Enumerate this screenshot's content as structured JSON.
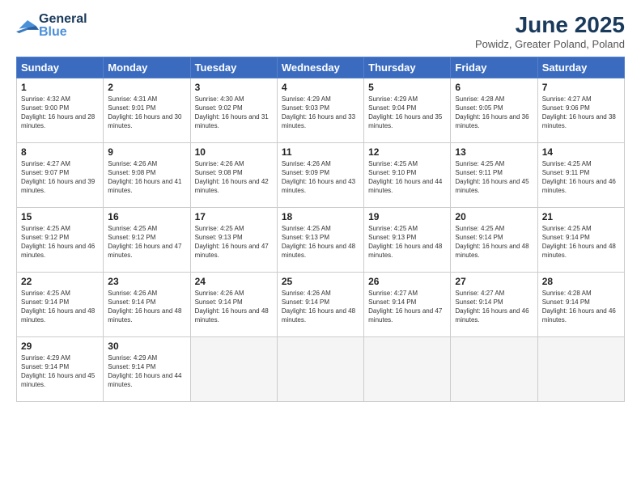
{
  "header": {
    "logo_general": "General",
    "logo_blue": "Blue",
    "title": "June 2025",
    "subtitle": "Powidz, Greater Poland, Poland"
  },
  "days_of_week": [
    "Sunday",
    "Monday",
    "Tuesday",
    "Wednesday",
    "Thursday",
    "Friday",
    "Saturday"
  ],
  "weeks": [
    [
      {
        "day": "1",
        "sunrise": "4:32 AM",
        "sunset": "9:00 PM",
        "daylight": "16 hours and 28 minutes."
      },
      {
        "day": "2",
        "sunrise": "4:31 AM",
        "sunset": "9:01 PM",
        "daylight": "16 hours and 30 minutes."
      },
      {
        "day": "3",
        "sunrise": "4:30 AM",
        "sunset": "9:02 PM",
        "daylight": "16 hours and 31 minutes."
      },
      {
        "day": "4",
        "sunrise": "4:29 AM",
        "sunset": "9:03 PM",
        "daylight": "16 hours and 33 minutes."
      },
      {
        "day": "5",
        "sunrise": "4:29 AM",
        "sunset": "9:04 PM",
        "daylight": "16 hours and 35 minutes."
      },
      {
        "day": "6",
        "sunrise": "4:28 AM",
        "sunset": "9:05 PM",
        "daylight": "16 hours and 36 minutes."
      },
      {
        "day": "7",
        "sunrise": "4:27 AM",
        "sunset": "9:06 PM",
        "daylight": "16 hours and 38 minutes."
      }
    ],
    [
      {
        "day": "8",
        "sunrise": "4:27 AM",
        "sunset": "9:07 PM",
        "daylight": "16 hours and 39 minutes."
      },
      {
        "day": "9",
        "sunrise": "4:26 AM",
        "sunset": "9:08 PM",
        "daylight": "16 hours and 41 minutes."
      },
      {
        "day": "10",
        "sunrise": "4:26 AM",
        "sunset": "9:08 PM",
        "daylight": "16 hours and 42 minutes."
      },
      {
        "day": "11",
        "sunrise": "4:26 AM",
        "sunset": "9:09 PM",
        "daylight": "16 hours and 43 minutes."
      },
      {
        "day": "12",
        "sunrise": "4:25 AM",
        "sunset": "9:10 PM",
        "daylight": "16 hours and 44 minutes."
      },
      {
        "day": "13",
        "sunrise": "4:25 AM",
        "sunset": "9:11 PM",
        "daylight": "16 hours and 45 minutes."
      },
      {
        "day": "14",
        "sunrise": "4:25 AM",
        "sunset": "9:11 PM",
        "daylight": "16 hours and 46 minutes."
      }
    ],
    [
      {
        "day": "15",
        "sunrise": "4:25 AM",
        "sunset": "9:12 PM",
        "daylight": "16 hours and 46 minutes."
      },
      {
        "day": "16",
        "sunrise": "4:25 AM",
        "sunset": "9:12 PM",
        "daylight": "16 hours and 47 minutes."
      },
      {
        "day": "17",
        "sunrise": "4:25 AM",
        "sunset": "9:13 PM",
        "daylight": "16 hours and 47 minutes."
      },
      {
        "day": "18",
        "sunrise": "4:25 AM",
        "sunset": "9:13 PM",
        "daylight": "16 hours and 48 minutes."
      },
      {
        "day": "19",
        "sunrise": "4:25 AM",
        "sunset": "9:13 PM",
        "daylight": "16 hours and 48 minutes."
      },
      {
        "day": "20",
        "sunrise": "4:25 AM",
        "sunset": "9:14 PM",
        "daylight": "16 hours and 48 minutes."
      },
      {
        "day": "21",
        "sunrise": "4:25 AM",
        "sunset": "9:14 PM",
        "daylight": "16 hours and 48 minutes."
      }
    ],
    [
      {
        "day": "22",
        "sunrise": "4:25 AM",
        "sunset": "9:14 PM",
        "daylight": "16 hours and 48 minutes."
      },
      {
        "day": "23",
        "sunrise": "4:26 AM",
        "sunset": "9:14 PM",
        "daylight": "16 hours and 48 minutes."
      },
      {
        "day": "24",
        "sunrise": "4:26 AM",
        "sunset": "9:14 PM",
        "daylight": "16 hours and 48 minutes."
      },
      {
        "day": "25",
        "sunrise": "4:26 AM",
        "sunset": "9:14 PM",
        "daylight": "16 hours and 48 minutes."
      },
      {
        "day": "26",
        "sunrise": "4:27 AM",
        "sunset": "9:14 PM",
        "daylight": "16 hours and 47 minutes."
      },
      {
        "day": "27",
        "sunrise": "4:27 AM",
        "sunset": "9:14 PM",
        "daylight": "16 hours and 46 minutes."
      },
      {
        "day": "28",
        "sunrise": "4:28 AM",
        "sunset": "9:14 PM",
        "daylight": "16 hours and 46 minutes."
      }
    ],
    [
      {
        "day": "29",
        "sunrise": "4:29 AM",
        "sunset": "9:14 PM",
        "daylight": "16 hours and 45 minutes."
      },
      {
        "day": "30",
        "sunrise": "4:29 AM",
        "sunset": "9:14 PM",
        "daylight": "16 hours and 44 minutes."
      }
    ]
  ]
}
